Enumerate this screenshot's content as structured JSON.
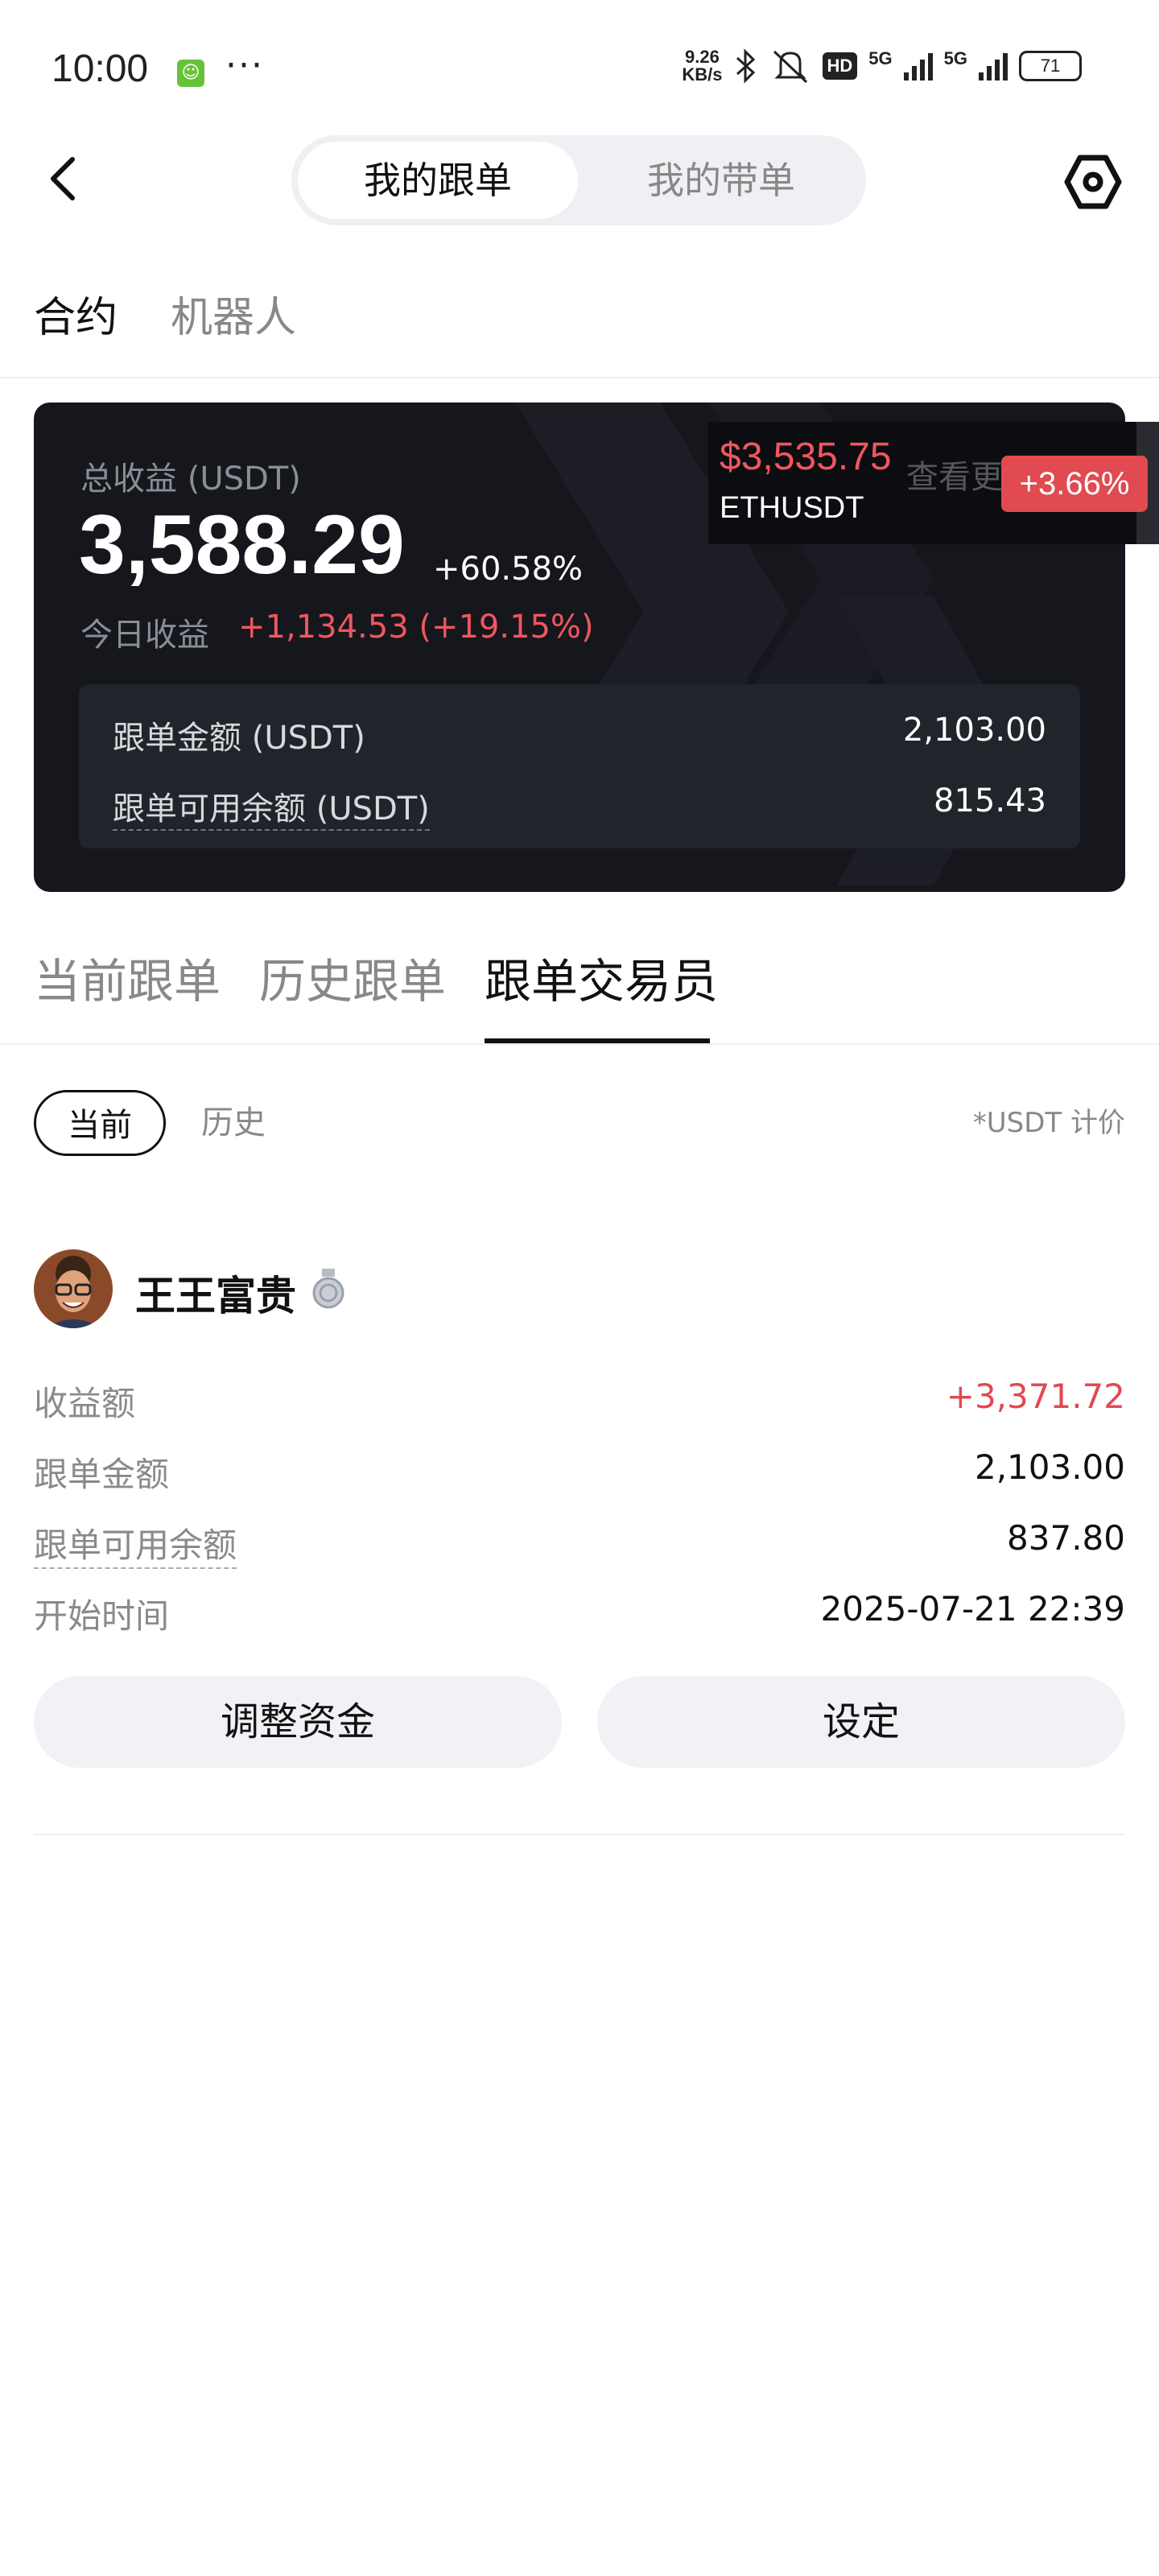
{
  "status_bar": {
    "time": "10:00",
    "net_speed_value": "9.26",
    "net_speed_unit": "KB/s",
    "hd": "HD",
    "net_a": "5G",
    "net_b": "5G",
    "battery": "71"
  },
  "header": {
    "segments": [
      "我的跟单",
      "我的带单"
    ]
  },
  "product_tabs": [
    "合约",
    "机器人"
  ],
  "summary": {
    "total_label": "总收益 (USDT)",
    "total_value": "3,588.29",
    "total_pct": "+60.58%",
    "today_label": "今日收益",
    "today_value": "+1,134.53 (+19.15%)",
    "rows": [
      {
        "label": "跟单金额 (USDT)",
        "value": "2,103.00"
      },
      {
        "label": "跟单可用余额 (USDT)",
        "value": "815.43"
      }
    ]
  },
  "ticker": {
    "price": "$3,535.75",
    "symbol": "ETHUSDT",
    "more": "查看更",
    "change": "+3.66%"
  },
  "position_tabs": [
    "当前跟单",
    "历史跟单",
    "跟单交易员"
  ],
  "filters": {
    "current": "当前",
    "history": "历史",
    "unit_note": "*USDT 计价"
  },
  "trader": {
    "name": "王王富贵",
    "details": [
      {
        "label": "收益额",
        "value": "+3,371.72"
      },
      {
        "label": "跟单金额",
        "value": "2,103.00"
      },
      {
        "label": "跟单可用余额",
        "value": "837.80"
      },
      {
        "label": "开始时间",
        "value": "2025-07-21 22:39"
      }
    ],
    "actions": [
      "调整资金",
      "设定"
    ]
  },
  "colors": {
    "accent_red": "#e04a50",
    "card_bg": "#16171d"
  },
  "icons": [
    "back-icon",
    "settings-icon",
    "medal-icon",
    "bluetooth-icon",
    "mute-icon"
  ]
}
